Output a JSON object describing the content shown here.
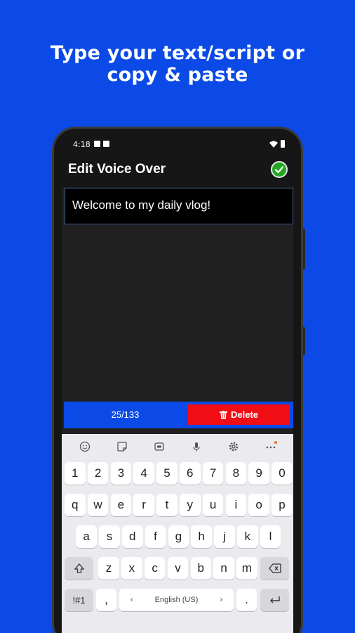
{
  "headline": {
    "line1": "Type your text/script  or",
    "line2": "copy & paste"
  },
  "status_bar": {
    "time": "4:18"
  },
  "app_bar": {
    "title": "Edit Voice Over"
  },
  "editor": {
    "text": "Welcome to my daily vlog!"
  },
  "footer": {
    "counter": "25/133",
    "delete_label": "Delete"
  },
  "keyboard": {
    "row_numbers": [
      "1",
      "2",
      "3",
      "4",
      "5",
      "6",
      "7",
      "8",
      "9",
      "0"
    ],
    "row_top": [
      "q",
      "w",
      "e",
      "r",
      "t",
      "y",
      "u",
      "i",
      "o",
      "p"
    ],
    "row_middle": [
      "a",
      "s",
      "d",
      "f",
      "g",
      "h",
      "j",
      "k",
      "l"
    ],
    "row_bottom": [
      "z",
      "x",
      "c",
      "v",
      "b",
      "n",
      "m"
    ],
    "symbols_label": "!#1",
    "comma": ",",
    "period": ".",
    "space_left": "‹",
    "space_label": "English (US)",
    "space_right": "›"
  },
  "colors": {
    "background": "#0b4ae6",
    "delete": "#f00d16",
    "confirm": "#22a722"
  }
}
